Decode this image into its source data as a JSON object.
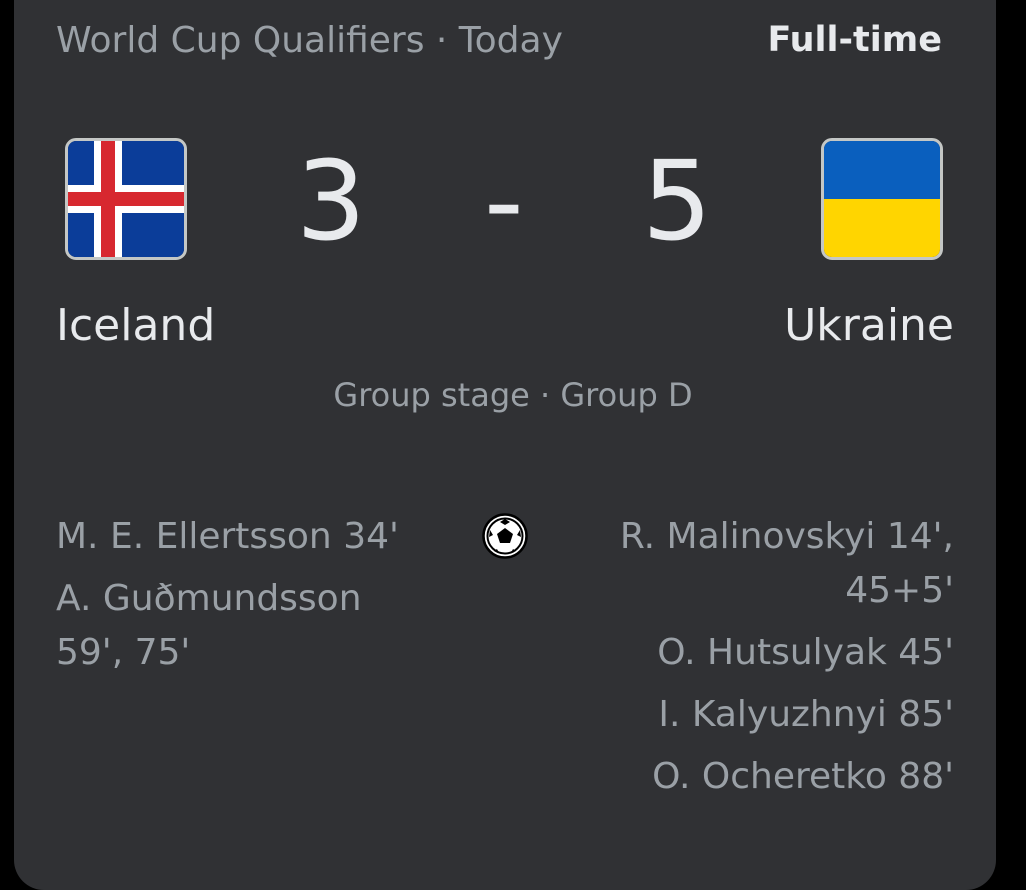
{
  "header": {
    "competition_and_date": "World Cup Qualifiers · Today",
    "status": "Full-time"
  },
  "home": {
    "name": "Iceland",
    "score": "3",
    "flag_icon": "iceland-flag-icon",
    "flag_colors": {
      "field": "#0b3d99",
      "cross_white": "#ffffff",
      "cross_red": "#d7282f"
    },
    "scorers": [
      "M. E. Ellertsson 34'",
      "A. Guðmundsson 59', 75'"
    ]
  },
  "separator": "-",
  "away": {
    "name": "Ukraine",
    "score": "5",
    "flag_icon": "ukraine-flag-icon",
    "flag_colors": {
      "top": "#0a5fbe",
      "bottom": "#ffd500"
    },
    "scorers": [
      "R. Malinovskyi 14', 45+5'",
      "O. Hutsulyak 45'",
      "I. Kalyuzhnyi 85'",
      "O. Ocheretko 88'"
    ]
  },
  "stage": "Group stage · Group D",
  "goals_icon": "soccer-ball-icon"
}
